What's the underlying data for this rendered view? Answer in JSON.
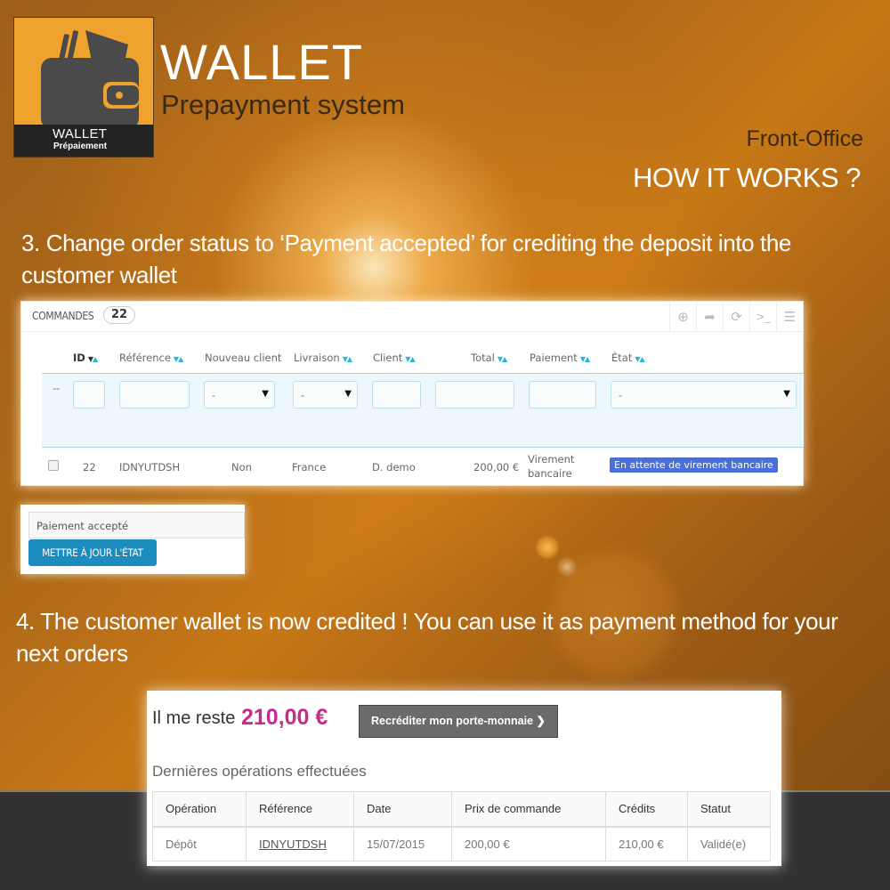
{
  "logo": {
    "icon": "wallet-icon",
    "band_line1": "WALLET",
    "band_line2": "Prépaiement",
    "colors": {
      "background": "#f0a22e",
      "band": "#232323"
    }
  },
  "header": {
    "title": "WALLET",
    "subtitle": "Prepayment system",
    "section": "Front-Office",
    "heading": "HOW IT WORKS ?"
  },
  "steps": [
    {
      "text": "3. Change order status to ‘Payment accepted’  for crediting the deposit into the customer wallet"
    },
    {
      "text": "4. The customer wallet is now credited ! You can use it as payment method for your next orders"
    }
  ],
  "orders_panel": {
    "title": "COMMANDES",
    "count": "22",
    "toolbar_icons": [
      "add-icon",
      "export-icon",
      "refresh-icon",
      "sql-query-icon",
      "database-icon"
    ],
    "columns": [
      {
        "label": "ID",
        "sortable": true
      },
      {
        "label": "Référence",
        "sortable": true
      },
      {
        "label": "Nouveau client",
        "sortable": false
      },
      {
        "label": "Livraison",
        "sortable": true
      },
      {
        "label": "Client",
        "sortable": true
      },
      {
        "label": "Total",
        "sortable": true
      },
      {
        "label": "Paiement",
        "sortable": true
      },
      {
        "label": "État",
        "sortable": true
      }
    ],
    "filters": {
      "row_marker": "--",
      "new_client_select": "-",
      "delivery_select": "-",
      "state_select": "-"
    },
    "rows": [
      {
        "id": "22",
        "reference": "IDNYUTDSH",
        "new_client": "Non",
        "delivery": "France",
        "client": "D. demo",
        "total": "200,00 €",
        "payment_line1": "Virement",
        "payment_line2": "bancaire",
        "state": "En attente de virement bancaire",
        "state_color": "#4a6fd6"
      }
    ]
  },
  "update_status": {
    "selected_status": "Paiement accepté",
    "button_label": "METTRE À JOUR L'ÉTAT",
    "button_color": "#1d8cbf"
  },
  "wallet_front": {
    "remaining_label": "Il me reste",
    "remaining_amount": "210,00 €",
    "amount_color": "#c72c8b",
    "recredit_button": "Recréditer mon porte-monnaie ❯",
    "operations_title": "Dernières opérations effectuées",
    "table": {
      "headers": [
        "Opération",
        "Référence",
        "Date",
        "Prix de commande",
        "Crédits",
        "Statut"
      ],
      "rows": [
        [
          "Dépôt",
          "IDNYUTDSH",
          "15/07/2015",
          "200,00 €",
          "210,00 €",
          "Validé(e)"
        ]
      ]
    }
  }
}
